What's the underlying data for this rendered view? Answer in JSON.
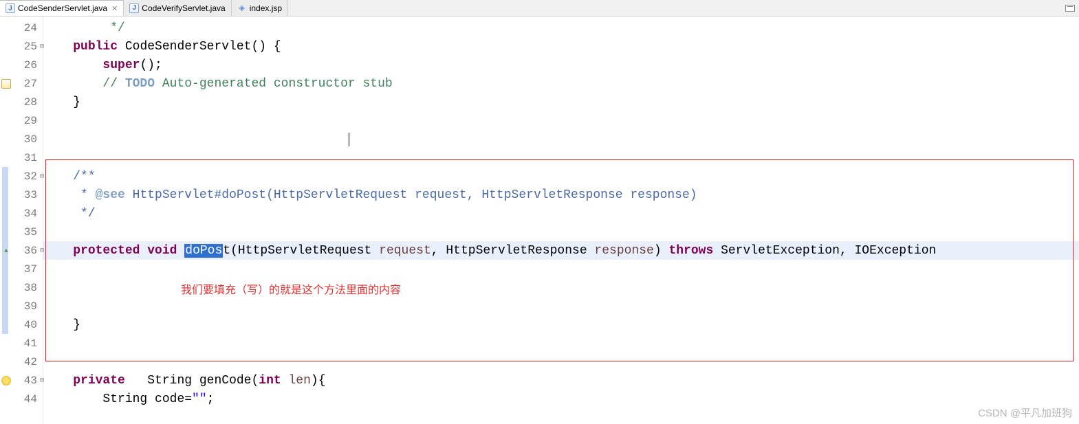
{
  "tabs": [
    {
      "label": "CodeSenderServlet.java",
      "iconType": "java",
      "active": true
    },
    {
      "label": "CodeVerifyServlet.java",
      "iconType": "java",
      "active": false
    },
    {
      "label": "index.jsp",
      "iconType": "jsp",
      "active": false
    }
  ],
  "gutter": {
    "start": 24,
    "end": 44,
    "foldable": [
      25,
      32,
      36,
      43
    ],
    "annotations": {
      "27": "quickfix",
      "36": "override",
      "43": "warning"
    }
  },
  "verticalBarRanges": [
    {
      "from": 32,
      "to": 40,
      "color": "#c8d8f4"
    }
  ],
  "code": {
    "l24": {
      "indent": "         ",
      "comment_close": "*/"
    },
    "l25": {
      "indent": "    ",
      "kw1": "public",
      "sp": " ",
      "name": "CodeSenderServlet",
      "rest": "() {"
    },
    "l26": {
      "indent": "        ",
      "kw1": "super",
      "rest": "();"
    },
    "l27": {
      "indent": "        ",
      "todo_slash": "// ",
      "todo_kw": "TODO",
      "todo_rest": " Auto-generated constructor stub"
    },
    "l28": {
      "indent": "    ",
      "text": "}"
    },
    "l29": {
      "text": ""
    },
    "l30": {
      "text": ""
    },
    "l31": {
      "text": ""
    },
    "l32": {
      "indent": "    ",
      "doc": "/**"
    },
    "l33": {
      "indent": "     ",
      "doc_pre": "* ",
      "tag": "@see",
      "doc_rest": " HttpServlet#doPost(HttpServletRequest request, HttpServletResponse response)"
    },
    "l34": {
      "indent": "     ",
      "doc": "*/"
    },
    "l35": {
      "text": ""
    },
    "l36": {
      "indent": "    ",
      "kw1": "protected",
      "sp1": " ",
      "kw2": "void",
      "sp2": " ",
      "sel": "doPos",
      "after_sel": "t",
      "t1": "(HttpServletRequest ",
      "p1": "request",
      "t2": ", HttpServletResponse ",
      "p2": "response",
      "t3": ") ",
      "kw3": "throws",
      "t4": " ServletException, IOException "
    },
    "l37": {
      "text": ""
    },
    "l38": {
      "text": ""
    },
    "l39": {
      "text": ""
    },
    "l40": {
      "indent": "    ",
      "text": "}"
    },
    "l41": {
      "text": ""
    },
    "l42": {
      "text": ""
    },
    "l43": {
      "indent": "    ",
      "kw1": "private",
      "sp1": "   ",
      "t1": "String genCode(",
      "kw2": "int",
      "sp2": " ",
      "p1": "len",
      "t2": "){"
    },
    "l44": {
      "indent": "        ",
      "t1": "String code=",
      "str": "\"\"",
      "t2": ";"
    }
  },
  "annotationText": "我们要填充（写）的就是这个方法里面的内容",
  "watermark": "CSDN @平凡加班狗",
  "redBox": {
    "topLine": 31,
    "bottomLine": 42,
    "leftPx": 63,
    "rightPx": 1561
  },
  "caretLine": 30,
  "highlightLine": 36
}
